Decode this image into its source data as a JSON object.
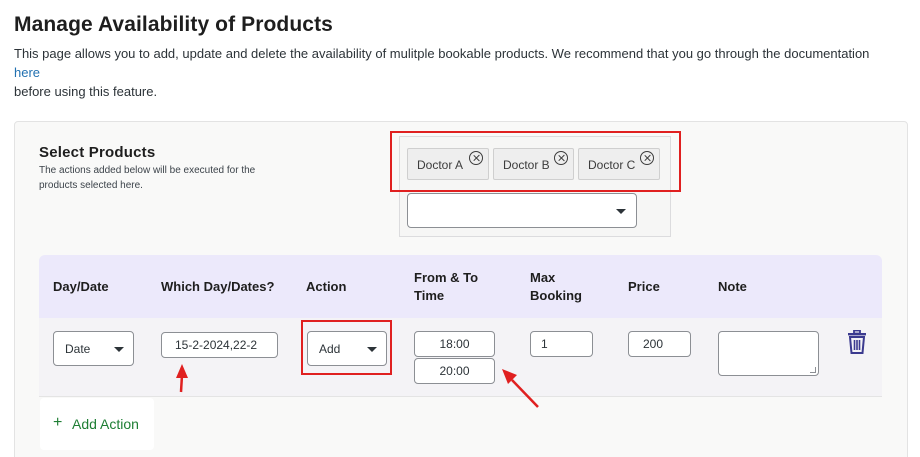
{
  "header": {
    "title": "Manage Availability of Products",
    "description": "This page allows you to add, update and delete the availability of mulitple bookable products. We recommend that you go through the documentation",
    "doc_link": "here",
    "description_tail": "before using this feature."
  },
  "select_products": {
    "title": "Select Products",
    "help": "The actions added below will be executed for the products selected here.",
    "chips": [
      "Doctor A",
      "Doctor B",
      "Doctor C"
    ],
    "dropdown_value": ""
  },
  "table": {
    "headers": {
      "day_date": "Day/Date",
      "which_day": "Which Day/Dates?",
      "action": "Action",
      "from_to_time": "From & To Time",
      "max_booking": "Max Booking",
      "price": "Price",
      "note": "Note"
    },
    "row": {
      "day_date": "Date",
      "which_dates": "15-2-2024,22-2",
      "action": "Add",
      "from_time": "18:00",
      "to_time": "20:00",
      "max_booking": "1",
      "price": "200",
      "note": ""
    }
  },
  "add_action": {
    "plus": "+",
    "label": "Add Action"
  },
  "icons": {
    "chip_remove": "circle-x-icon",
    "select_caret": "caret-down-icon",
    "delete": "trash-icon"
  },
  "colors": {
    "header_row": "#ece9fb",
    "annotation": "#e02020",
    "add_action_text": "#1e7e34",
    "trash": "#3b3a8f"
  }
}
